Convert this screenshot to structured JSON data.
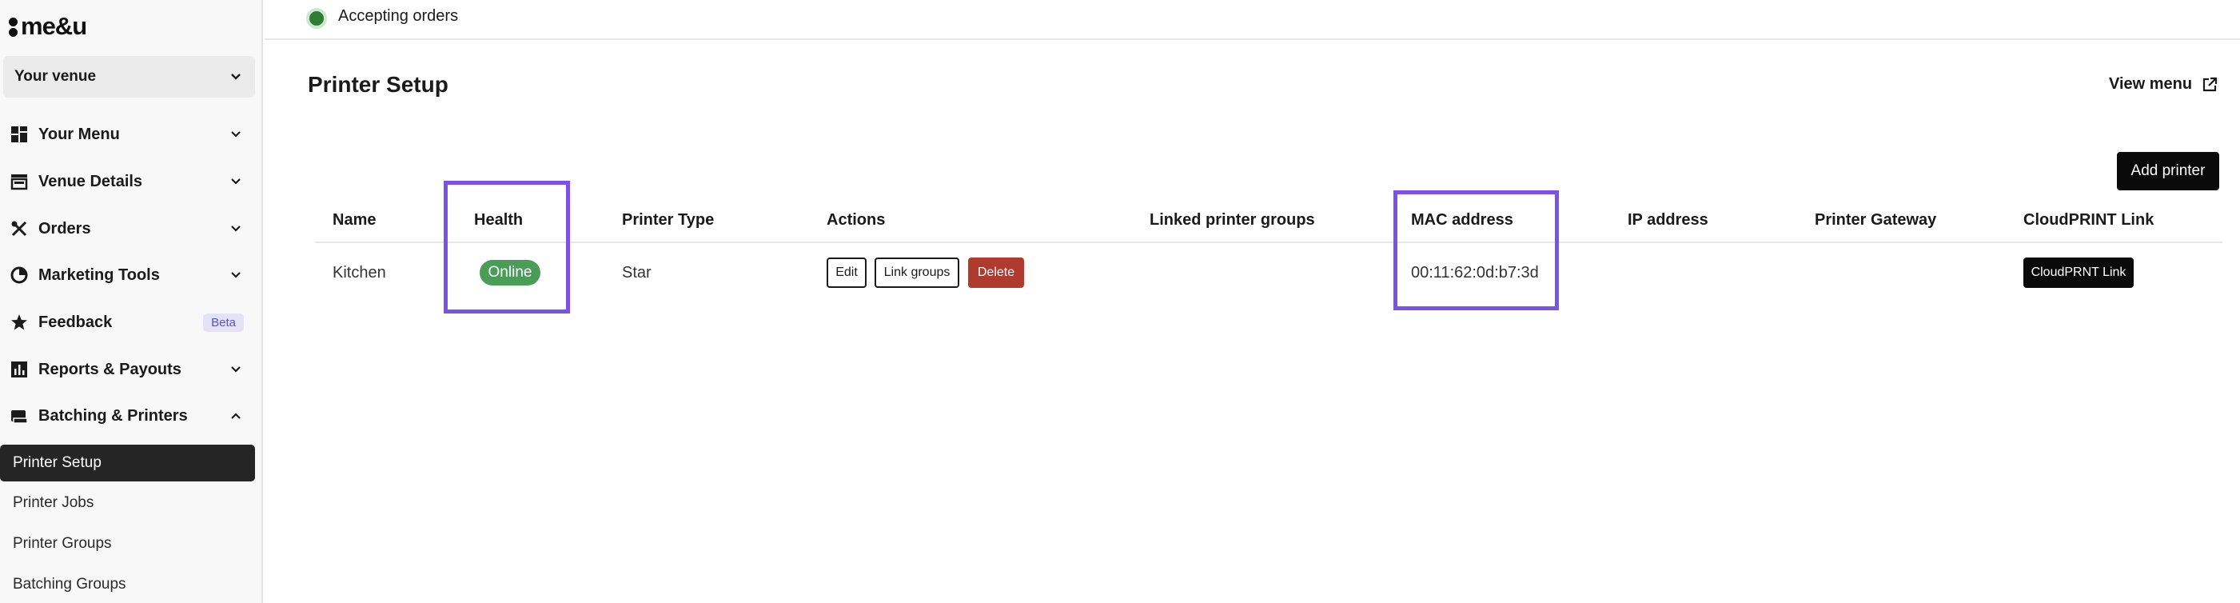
{
  "brand": {
    "logo_text": "me&u"
  },
  "venue_select": {
    "label": "Your venue"
  },
  "sidebar": {
    "items": [
      {
        "label": "Your Menu",
        "icon": "grid-icon"
      },
      {
        "label": "Venue Details",
        "icon": "storefront-icon"
      },
      {
        "label": "Orders",
        "icon": "utensils-icon"
      },
      {
        "label": "Marketing Tools",
        "icon": "pie-chart-icon"
      },
      {
        "label": "Feedback",
        "icon": "star-icon",
        "badge": "Beta"
      },
      {
        "label": "Reports & Payouts",
        "icon": "bar-chart-icon"
      },
      {
        "label": "Batching & Printers",
        "icon": "printer-icon"
      }
    ],
    "subitems": [
      "Printer Setup",
      "Printer Jobs",
      "Printer Groups",
      "Batching Groups"
    ]
  },
  "topbar": {
    "status": "Accepting orders",
    "status_color": "#2e7d32"
  },
  "page": {
    "title": "Printer Setup",
    "view_menu": "View menu",
    "add_printer": "Add printer"
  },
  "table": {
    "headers": [
      "Name",
      "Health",
      "Printer Type",
      "Actions",
      "Linked printer groups",
      "MAC address",
      "IP address",
      "Printer Gateway",
      "CloudPRINT Link"
    ],
    "rows": [
      {
        "name": "Kitchen",
        "health": "Online",
        "printer_type": "Star",
        "actions": {
          "edit": "Edit",
          "link_groups": "Link groups",
          "delete": "Delete"
        },
        "linked_printer_groups": "",
        "mac_address": "00:11:62:0d:b7:3d",
        "ip_address": "",
        "printer_gateway": "",
        "cloudprint_link": "CloudPRNT Link"
      }
    ]
  },
  "colors": {
    "highlight": "#7b52e8",
    "health_online": "#4a9d57",
    "delete": "#b03a2e"
  }
}
